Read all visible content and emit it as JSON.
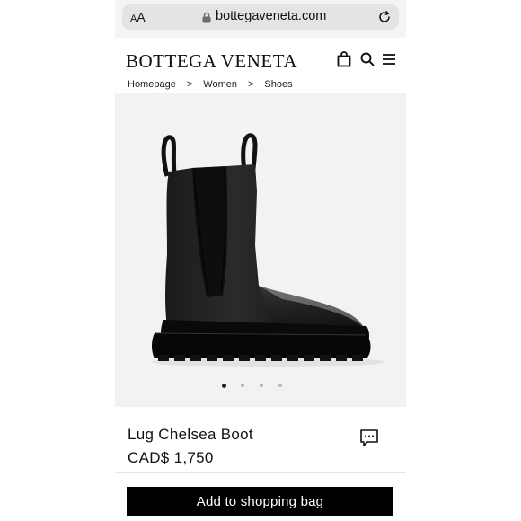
{
  "browser": {
    "text_size_label": "AA",
    "url": "bottegaveneta.com",
    "icons": [
      "lock-icon",
      "reload-icon"
    ]
  },
  "header": {
    "brand": "BOTTEGA VENETA",
    "icons": [
      "shopping-bag-icon",
      "search-icon",
      "menu-icon"
    ]
  },
  "breadcrumb": {
    "items": [
      "Homepage",
      "Women",
      "Shoes"
    ],
    "separator": ">"
  },
  "gallery": {
    "image": "black chelsea boot with lug sole",
    "slide_count": 4,
    "active_slide": 1
  },
  "product": {
    "name": "Lug Chelsea Boot",
    "price": "CAD$ 1,750",
    "chat_icon": "chat-bubble-icon"
  },
  "actions": {
    "add_to_bag_label": "Add to shopping bag"
  },
  "colors": {
    "cta_background": "#000000",
    "cta_text": "#ffffff",
    "gallery_background": "#f2f2f2"
  }
}
